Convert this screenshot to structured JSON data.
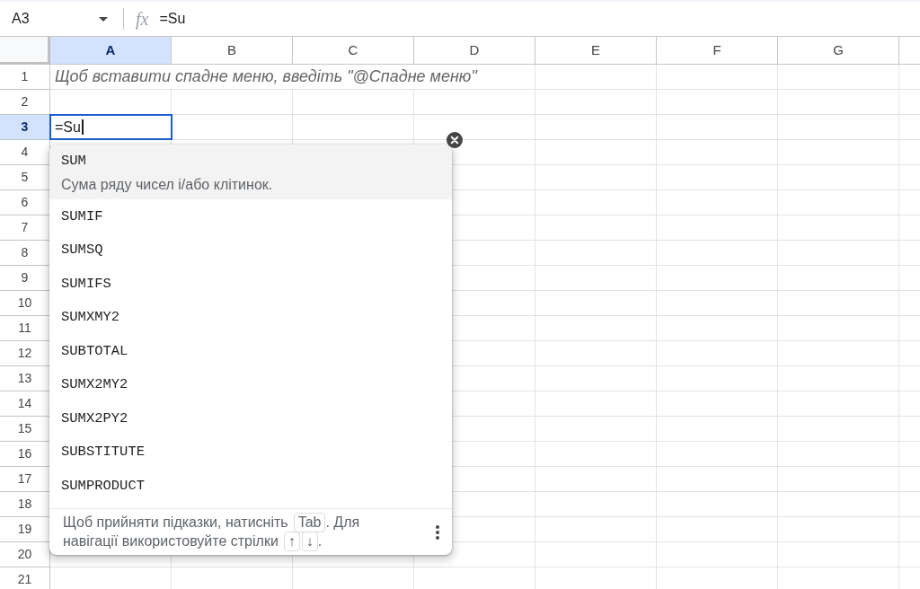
{
  "formula_bar": {
    "name_box": "A3",
    "fx_label": "fx",
    "formula": "=Su"
  },
  "columns": [
    {
      "label": "A",
      "selected": true
    },
    {
      "label": "B",
      "selected": false
    },
    {
      "label": "C",
      "selected": false
    },
    {
      "label": "D",
      "selected": false
    },
    {
      "label": "E",
      "selected": false
    },
    {
      "label": "F",
      "selected": false
    },
    {
      "label": "G",
      "selected": false
    }
  ],
  "rows": [
    {
      "label": "1",
      "selected": false,
      "cell_a": {
        "kind": "note",
        "text": "Щоб вставити спадне меню, введіть \"@Спадне меню\""
      }
    },
    {
      "label": "2",
      "selected": false
    },
    {
      "label": "3",
      "selected": true,
      "cell_a": {
        "kind": "editor",
        "text": "=Su"
      }
    },
    {
      "label": "4",
      "selected": false
    },
    {
      "label": "5",
      "selected": false
    },
    {
      "label": "6",
      "selected": false
    },
    {
      "label": "7",
      "selected": false
    },
    {
      "label": "8",
      "selected": false
    },
    {
      "label": "9",
      "selected": false
    },
    {
      "label": "10",
      "selected": false
    },
    {
      "label": "11",
      "selected": false
    },
    {
      "label": "12",
      "selected": false
    },
    {
      "label": "13",
      "selected": false
    },
    {
      "label": "14",
      "selected": false
    },
    {
      "label": "15",
      "selected": false
    },
    {
      "label": "16",
      "selected": false
    },
    {
      "label": "17",
      "selected": false
    },
    {
      "label": "18",
      "selected": false
    },
    {
      "label": "19",
      "selected": false
    },
    {
      "label": "20",
      "selected": false
    },
    {
      "label": "21",
      "selected": false
    }
  ],
  "autocomplete": {
    "suggestions": [
      {
        "name": "SUM",
        "selected": true,
        "description": "Сума ряду чисел і/або клітинок."
      },
      {
        "name": "SUMIF",
        "selected": false
      },
      {
        "name": "SUMSQ",
        "selected": false
      },
      {
        "name": "SUMIFS",
        "selected": false
      },
      {
        "name": "SUMXMY2",
        "selected": false
      },
      {
        "name": "SUBTOTAL",
        "selected": false
      },
      {
        "name": "SUMX2MY2",
        "selected": false
      },
      {
        "name": "SUMX2PY2",
        "selected": false
      },
      {
        "name": "SUBSTITUTE",
        "selected": false
      },
      {
        "name": "SUMPRODUCT",
        "selected": false
      }
    ],
    "footer": {
      "lines": [
        [
          {
            "kind": "text",
            "text": "Щоб прийняти підказки, натисніть"
          },
          {
            "kind": "key",
            "text": "Tab"
          },
          {
            "kind": "text",
            "text": ". Для"
          }
        ],
        [
          {
            "kind": "text",
            "text": "навігації використовуйте стрілки"
          },
          {
            "kind": "key",
            "text": "↑"
          },
          {
            "kind": "key",
            "text": "↓"
          },
          {
            "kind": "text",
            "text": "."
          }
        ]
      ]
    }
  }
}
